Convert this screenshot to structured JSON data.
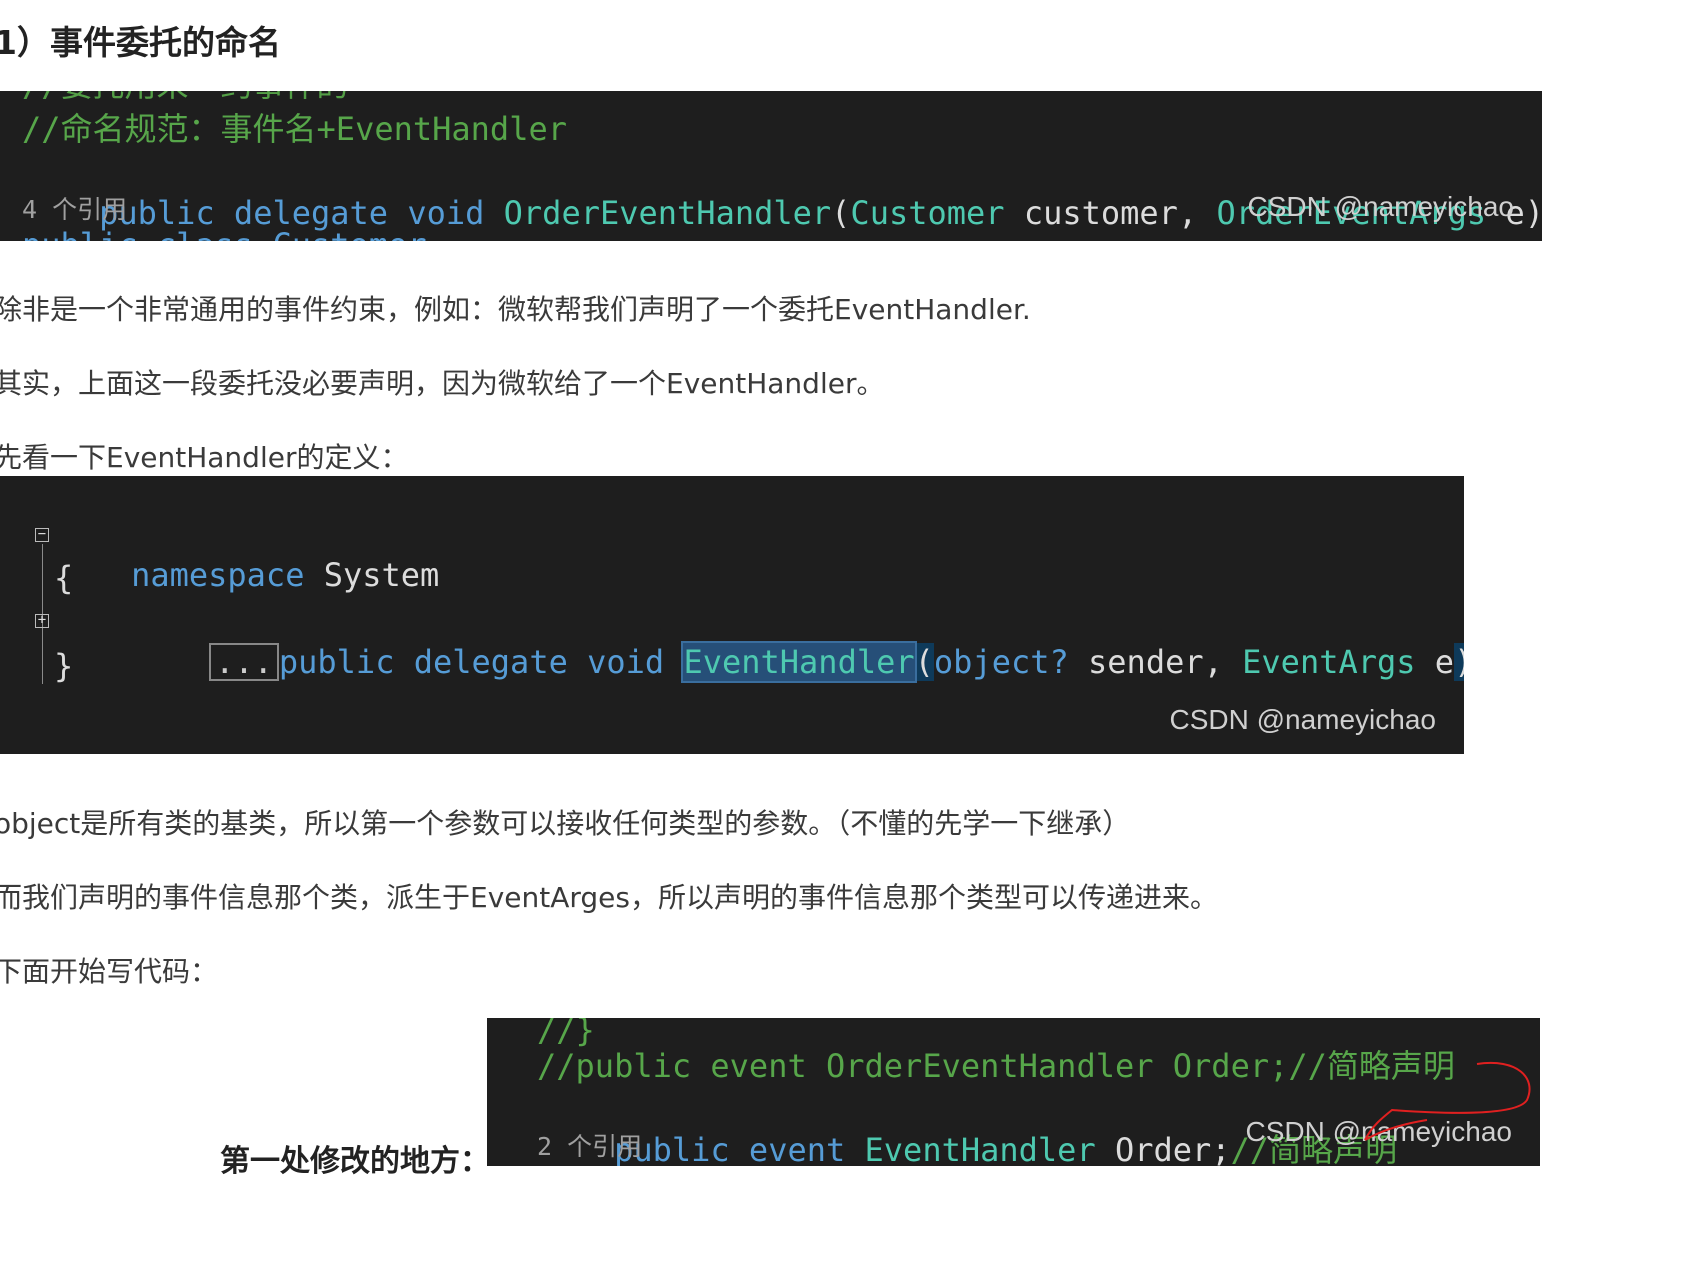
{
  "heading": "1）事件委托的命名",
  "block1": {
    "cut_top": "//委托用来一约事件的",
    "comment": "//命名规范：事件名+EventHandler",
    "kw_public": "public",
    "kw_delegate": "delegate",
    "kw_void": "void",
    "type_handler": "OrderEventHandler",
    "paren_open": "(",
    "type_customer": "Customer",
    "arg_customer": "customer,",
    "type_args": "OrderEventArgs",
    "arg_e": "e);",
    "refs": "4 个引用",
    "cut_bottom": "public class Customer",
    "watermark": "CSDN @nameyichao"
  },
  "para1": "除非是一个非常通用的事件约束，例如：微软帮我们声明了一个委托EventHandler.",
  "para2": "其实，上面这一段委托没必要声明，因为微软给了一个EventHandler。",
  "para3": "先看一下EventHandler的定义：",
  "block2": {
    "kw_namespace": "namespace",
    "ns_name": "System",
    "brace_open": "{",
    "collapsed": "...",
    "kw_public": "public",
    "kw_delegate": "delegate",
    "kw_void": "void",
    "type_handler": "EventHandler",
    "paren_open": "(",
    "kw_object": "object?",
    "arg_sender": "sender,",
    "type_args": "EventArgs",
    "arg_e": "e",
    "end": ");",
    "brace_close": "}",
    "fold_minus": "−",
    "fold_plus": "+",
    "watermark": "CSDN @nameyichao"
  },
  "para4": "object是所有类的基类，所以第一个参数可以接收任何类型的参数。（不懂的先学一下继承）",
  "para5": "而我们声明的事件信息那个类，派生于EventArges，所以声明的事件信息那个类型可以传递进来。",
  "para6": "下面开始写代码：",
  "label_first_change": "第一处修改的地方：",
  "block3": {
    "cut_top": "//}",
    "line1_comment": "//public event OrderEventHandler Order;//简略声明",
    "kw_public": "public",
    "kw_event": "event",
    "type_handler": "EventHandler",
    "id_order": "Order;",
    "comment": "//简略声明",
    "refs": "2 个引用",
    "watermark": "CSDN @nameyichao"
  },
  "colors": {
    "code_bg": "#1e1e1e",
    "comment": "#57a64a",
    "keyword": "#569cd6",
    "type": "#4ec9b0",
    "annotation": "#e02020"
  }
}
